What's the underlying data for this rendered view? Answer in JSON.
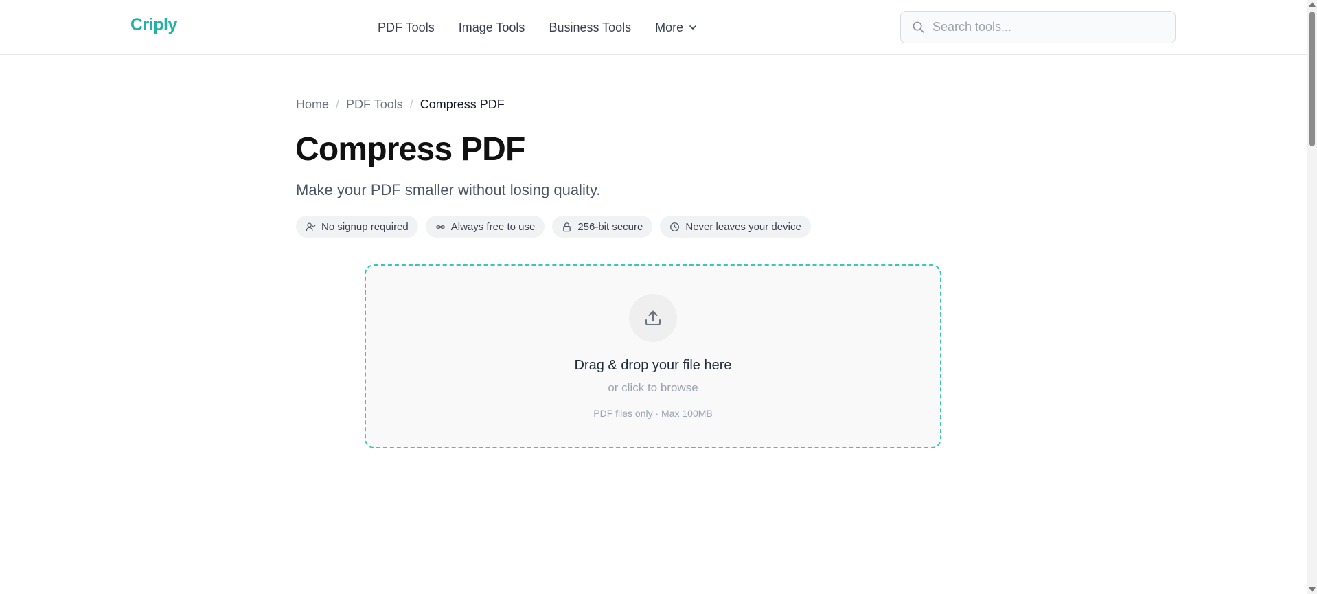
{
  "header": {
    "logo": "Criply",
    "nav": [
      {
        "label": "PDF Tools"
      },
      {
        "label": "Image Tools"
      },
      {
        "label": "Business Tools"
      },
      {
        "label": "More"
      }
    ],
    "search_placeholder": "Search tools..."
  },
  "breadcrumb": {
    "home": "Home",
    "section": "PDF Tools",
    "current": "Compress PDF",
    "separator": "/"
  },
  "page": {
    "title": "Compress PDF",
    "subtitle": "Make your PDF smaller without losing quality."
  },
  "badges": [
    {
      "icon": "user-check-icon",
      "label": "No signup required"
    },
    {
      "icon": "infinity-icon",
      "label": "Always free to use"
    },
    {
      "icon": "lock-icon",
      "label": "256-bit secure"
    },
    {
      "icon": "clock-icon",
      "label": "Never leaves your device"
    }
  ],
  "dropzone": {
    "icon": "upload-icon",
    "title": "Drag & drop your file here",
    "subtitle": "or click to browse",
    "hint": "PDF files only · Max 100MB"
  },
  "colors": {
    "brand": "#20b2a3",
    "dropzone_border": "#3cc6b9"
  }
}
